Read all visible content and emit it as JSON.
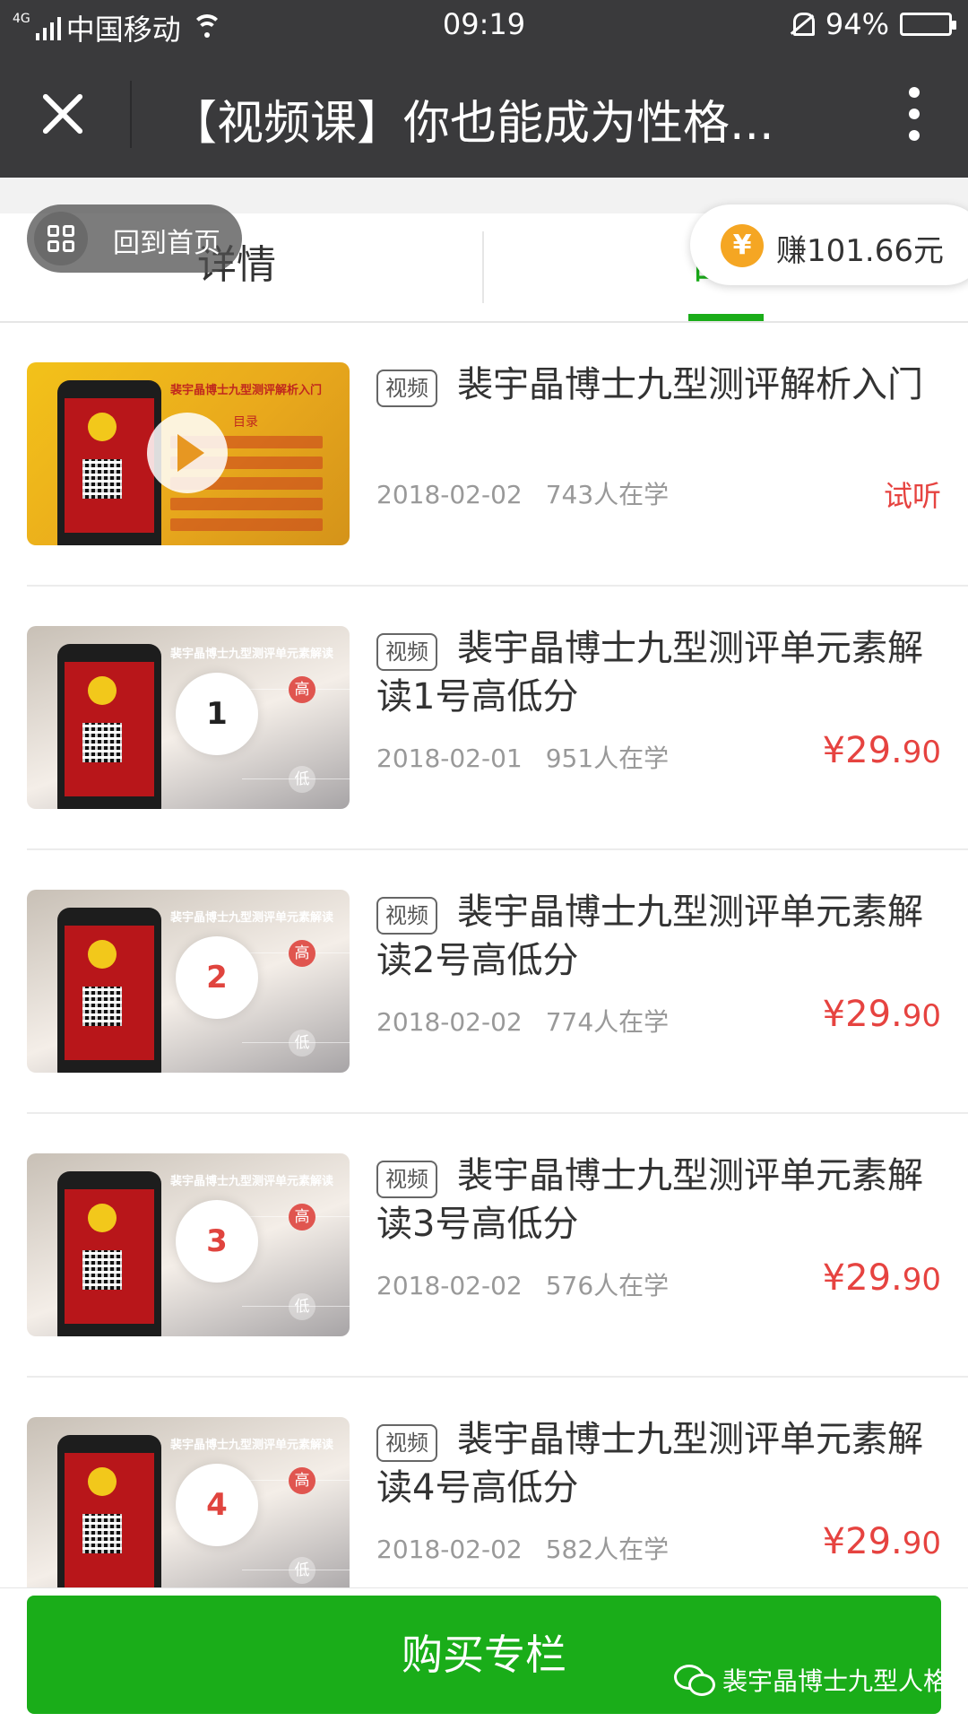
{
  "status_bar": {
    "network": "4G",
    "carrier": "中国移动",
    "time": "09:19",
    "battery": "94%",
    "battery_level": 0.94
  },
  "nav": {
    "title": "【视频课】你也能成为性格..."
  },
  "tabs": {
    "detail": "详情",
    "directory": "目录"
  },
  "floating": {
    "home_label": "回到首页",
    "earn_label": "赚101.66元",
    "coin_symbol": "¥"
  },
  "items": [
    {
      "tag": "视频",
      "title": "裴宇晶博士九型测评解析入门",
      "date": "2018-02-02",
      "students": "743人在学",
      "trial": "试听",
      "thumb_title": "裴宇晶博士九型测评解析入门",
      "thumb_menu": "目录"
    },
    {
      "tag": "视频",
      "title": "裴宇晶博士九型测评单元素解读1号高低分",
      "date": "2018-02-01",
      "students": "951人在学",
      "price_main": "¥29.",
      "price_dec": "90",
      "thumb_title": "裴宇晶博士九型测评单元素解读",
      "thumb_num": "1"
    },
    {
      "tag": "视频",
      "title": "裴宇晶博士九型测评单元素解读2号高低分",
      "date": "2018-02-02",
      "students": "774人在学",
      "price_main": "¥29.",
      "price_dec": "90",
      "thumb_title": "裴宇晶博士九型测评单元素解读",
      "thumb_num": "2"
    },
    {
      "tag": "视频",
      "title": "裴宇晶博士九型测评单元素解读3号高低分",
      "date": "2018-02-02",
      "students": "576人在学",
      "price_main": "¥29.",
      "price_dec": "90",
      "thumb_title": "裴宇晶博士九型测评单元素解读",
      "thumb_num": "3"
    },
    {
      "tag": "视频",
      "title": "裴宇晶博士九型测评单元素解读4号高低分",
      "date": "2018-02-02",
      "students": "582人在学",
      "price_main": "¥29.",
      "price_dec": "90",
      "thumb_title": "裴宇晶博士九型测评单元素解读",
      "thumb_num": "4"
    }
  ],
  "thumb_labels": {
    "high": "高",
    "low": "低"
  },
  "bottom": {
    "buy_label": "购买专栏",
    "watermark": "裴宇晶博士九型人格"
  },
  "colors": {
    "bar": "#3a3a3c",
    "accent_green": "#1aad19",
    "price_red": "#e64340",
    "coin": "#f5a623"
  }
}
